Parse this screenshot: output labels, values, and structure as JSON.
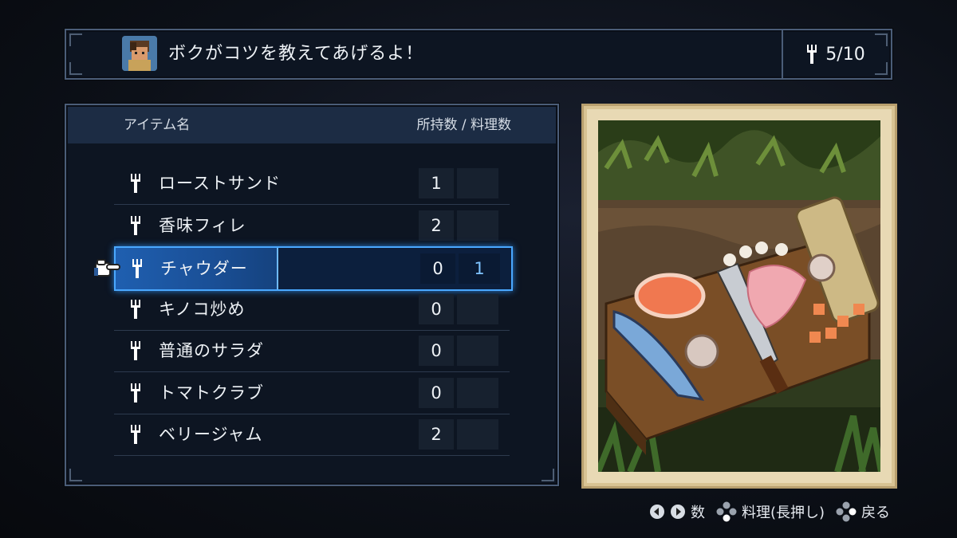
{
  "top_bar": {
    "dialogue": "ボクがコツを教えてあげるよ！",
    "count": "5/10"
  },
  "list": {
    "header_name": "アイテム名",
    "header_counts": "所持数 / 料理数",
    "items": [
      {
        "name": "ローストサンド",
        "owned": "1",
        "cook": ""
      },
      {
        "name": "香味フィレ",
        "owned": "2",
        "cook": ""
      },
      {
        "name": "チャウダー",
        "owned": "0",
        "cook": "1"
      },
      {
        "name": "キノコ炒め",
        "owned": "0",
        "cook": ""
      },
      {
        "name": "普通のサラダ",
        "owned": "0",
        "cook": ""
      },
      {
        "name": "トマトクラブ",
        "owned": "0",
        "cook": ""
      },
      {
        "name": "ベリージャム",
        "owned": "2",
        "cook": ""
      }
    ],
    "selected_index": 2
  },
  "footer": {
    "count_label": "数",
    "cook_label": "料理(長押し)",
    "back_label": "戻る"
  },
  "icons": {
    "fork": "fork-icon",
    "pointer": "pointing-hand-icon",
    "dpad_left": "left-button-icon",
    "dpad_right": "right-button-icon",
    "face_buttons": "face-buttons-icon"
  },
  "colors": {
    "accent": "#4aa8ff",
    "selected_fill": "#1f5fb0",
    "panel": "#0d1522"
  }
}
